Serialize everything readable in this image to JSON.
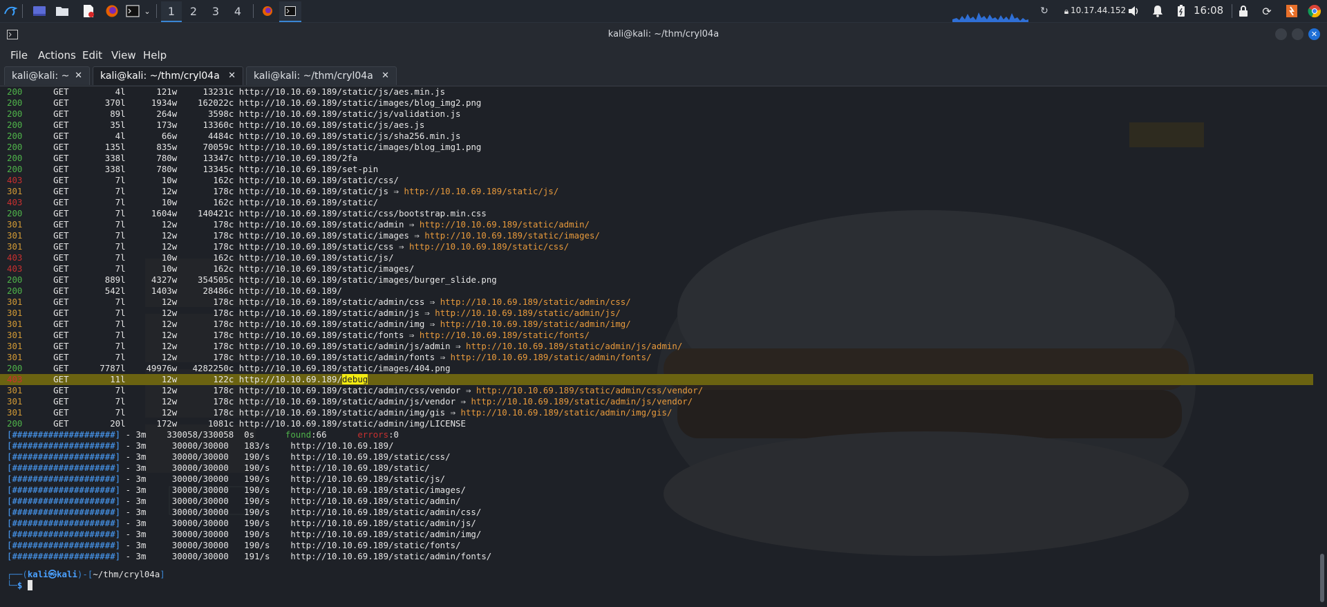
{
  "panel": {
    "workspaces": [
      "1",
      "2",
      "3",
      "4"
    ],
    "active_workspace": "1",
    "ip": "10.17.44.152",
    "time": "16:08"
  },
  "window": {
    "title": "kali@kali: ~/thm/cryl04a"
  },
  "menu": [
    "File",
    "Actions",
    "Edit",
    "View",
    "Help"
  ],
  "tabs": [
    {
      "label": "kali@kali: ~"
    },
    {
      "label": "kali@kali: ~/thm/cryl04a"
    },
    {
      "label": "kali@kali: ~/thm/cryl04a"
    }
  ],
  "results": [
    {
      "code": "200",
      "method": "GET",
      "lines": "4l",
      "words": "121w",
      "chars": "13231c",
      "url": "http://10.10.69.189/static/js/aes.min.js",
      "redirect": ""
    },
    {
      "code": "200",
      "method": "GET",
      "lines": "370l",
      "words": "1934w",
      "chars": "162022c",
      "url": "http://10.10.69.189/static/images/blog_img2.png",
      "redirect": ""
    },
    {
      "code": "200",
      "method": "GET",
      "lines": "89l",
      "words": "264w",
      "chars": "3598c",
      "url": "http://10.10.69.189/static/js/validation.js",
      "redirect": ""
    },
    {
      "code": "200",
      "method": "GET",
      "lines": "35l",
      "words": "173w",
      "chars": "13360c",
      "url": "http://10.10.69.189/static/js/aes.js",
      "redirect": ""
    },
    {
      "code": "200",
      "method": "GET",
      "lines": "4l",
      "words": "66w",
      "chars": "4484c",
      "url": "http://10.10.69.189/static/js/sha256.min.js",
      "redirect": ""
    },
    {
      "code": "200",
      "method": "GET",
      "lines": "135l",
      "words": "835w",
      "chars": "70059c",
      "url": "http://10.10.69.189/static/images/blog_img1.png",
      "redirect": ""
    },
    {
      "code": "200",
      "method": "GET",
      "lines": "338l",
      "words": "780w",
      "chars": "13347c",
      "url": "http://10.10.69.189/2fa",
      "redirect": ""
    },
    {
      "code": "200",
      "method": "GET",
      "lines": "338l",
      "words": "780w",
      "chars": "13345c",
      "url": "http://10.10.69.189/set-pin",
      "redirect": ""
    },
    {
      "code": "403",
      "method": "GET",
      "lines": "7l",
      "words": "10w",
      "chars": "162c",
      "url": "http://10.10.69.189/static/css/",
      "redirect": ""
    },
    {
      "code": "301",
      "method": "GET",
      "lines": "7l",
      "words": "12w",
      "chars": "178c",
      "url": "http://10.10.69.189/static/js",
      "redirect": "http://10.10.69.189/static/js/"
    },
    {
      "code": "403",
      "method": "GET",
      "lines": "7l",
      "words": "10w",
      "chars": "162c",
      "url": "http://10.10.69.189/static/",
      "redirect": ""
    },
    {
      "code": "200",
      "method": "GET",
      "lines": "7l",
      "words": "1604w",
      "chars": "140421c",
      "url": "http://10.10.69.189/static/css/bootstrap.min.css",
      "redirect": ""
    },
    {
      "code": "301",
      "method": "GET",
      "lines": "7l",
      "words": "12w",
      "chars": "178c",
      "url": "http://10.10.69.189/static/admin",
      "redirect": "http://10.10.69.189/static/admin/"
    },
    {
      "code": "301",
      "method": "GET",
      "lines": "7l",
      "words": "12w",
      "chars": "178c",
      "url": "http://10.10.69.189/static/images",
      "redirect": "http://10.10.69.189/static/images/"
    },
    {
      "code": "301",
      "method": "GET",
      "lines": "7l",
      "words": "12w",
      "chars": "178c",
      "url": "http://10.10.69.189/static/css",
      "redirect": "http://10.10.69.189/static/css/"
    },
    {
      "code": "403",
      "method": "GET",
      "lines": "7l",
      "words": "10w",
      "chars": "162c",
      "url": "http://10.10.69.189/static/js/",
      "redirect": ""
    },
    {
      "code": "403",
      "method": "GET",
      "lines": "7l",
      "words": "10w",
      "chars": "162c",
      "url": "http://10.10.69.189/static/images/",
      "redirect": ""
    },
    {
      "code": "200",
      "method": "GET",
      "lines": "889l",
      "words": "4327w",
      "chars": "354505c",
      "url": "http://10.10.69.189/static/images/burger_slide.png",
      "redirect": ""
    },
    {
      "code": "200",
      "method": "GET",
      "lines": "542l",
      "words": "1403w",
      "chars": "28486c",
      "url": "http://10.10.69.189/",
      "redirect": ""
    },
    {
      "code": "301",
      "method": "GET",
      "lines": "7l",
      "words": "12w",
      "chars": "178c",
      "url": "http://10.10.69.189/static/admin/css",
      "redirect": "http://10.10.69.189/static/admin/css/"
    },
    {
      "code": "301",
      "method": "GET",
      "lines": "7l",
      "words": "12w",
      "chars": "178c",
      "url": "http://10.10.69.189/static/admin/js",
      "redirect": "http://10.10.69.189/static/admin/js/"
    },
    {
      "code": "301",
      "method": "GET",
      "lines": "7l",
      "words": "12w",
      "chars": "178c",
      "url": "http://10.10.69.189/static/admin/img",
      "redirect": "http://10.10.69.189/static/admin/img/"
    },
    {
      "code": "301",
      "method": "GET",
      "lines": "7l",
      "words": "12w",
      "chars": "178c",
      "url": "http://10.10.69.189/static/fonts",
      "redirect": "http://10.10.69.189/static/fonts/"
    },
    {
      "code": "301",
      "method": "GET",
      "lines": "7l",
      "words": "12w",
      "chars": "178c",
      "url": "http://10.10.69.189/static/admin/js/admin",
      "redirect": "http://10.10.69.189/static/admin/js/admin/"
    },
    {
      "code": "301",
      "method": "GET",
      "lines": "7l",
      "words": "12w",
      "chars": "178c",
      "url": "http://10.10.69.189/static/admin/fonts",
      "redirect": "http://10.10.69.189/static/admin/fonts/"
    },
    {
      "code": "200",
      "method": "GET",
      "lines": "7787l",
      "words": "49976w",
      "chars": "4282250c",
      "url": "http://10.10.69.189/static/images/404.png",
      "redirect": ""
    },
    {
      "code": "403",
      "method": "GET",
      "lines": "11l",
      "words": "12w",
      "chars": "122c",
      "url": "http://10.10.69.189/",
      "url_highlight": "debug",
      "redirect": "",
      "highlight": true
    },
    {
      "code": "301",
      "method": "GET",
      "lines": "7l",
      "words": "12w",
      "chars": "178c",
      "url": "http://10.10.69.189/static/admin/css/vendor",
      "redirect": "http://10.10.69.189/static/admin/css/vendor/"
    },
    {
      "code": "301",
      "method": "GET",
      "lines": "7l",
      "words": "12w",
      "chars": "178c",
      "url": "http://10.10.69.189/static/admin/js/vendor",
      "redirect": "http://10.10.69.189/static/admin/js/vendor/"
    },
    {
      "code": "301",
      "method": "GET",
      "lines": "7l",
      "words": "12w",
      "chars": "178c",
      "url": "http://10.10.69.189/static/admin/img/gis",
      "redirect": "http://10.10.69.189/static/admin/img/gis/"
    },
    {
      "code": "200",
      "method": "GET",
      "lines": "20l",
      "words": "172w",
      "chars": "1081c",
      "url": "http://10.10.69.189/static/admin/img/LICENSE",
      "redirect": ""
    }
  ],
  "summary": {
    "bar": "[####################]",
    "time": "- 3m",
    "count": "330058/330058",
    "rate": "0s",
    "found_label": "found",
    "found": "66",
    "errors_label": "errors",
    "errors": "0"
  },
  "progress": [
    {
      "bar": "[####################]",
      "time": "- 3m",
      "count": "30000/30000",
      "rate": "183/s",
      "url": "http://10.10.69.189/"
    },
    {
      "bar": "[####################]",
      "time": "- 3m",
      "count": "30000/30000",
      "rate": "190/s",
      "url": "http://10.10.69.189/static/css/"
    },
    {
      "bar": "[####################]",
      "time": "- 3m",
      "count": "30000/30000",
      "rate": "190/s",
      "url": "http://10.10.69.189/static/"
    },
    {
      "bar": "[####################]",
      "time": "- 3m",
      "count": "30000/30000",
      "rate": "190/s",
      "url": "http://10.10.69.189/static/js/"
    },
    {
      "bar": "[####################]",
      "time": "- 3m",
      "count": "30000/30000",
      "rate": "190/s",
      "url": "http://10.10.69.189/static/images/"
    },
    {
      "bar": "[####################]",
      "time": "- 3m",
      "count": "30000/30000",
      "rate": "190/s",
      "url": "http://10.10.69.189/static/admin/"
    },
    {
      "bar": "[####################]",
      "time": "- 3m",
      "count": "30000/30000",
      "rate": "190/s",
      "url": "http://10.10.69.189/static/admin/css/"
    },
    {
      "bar": "[####################]",
      "time": "- 3m",
      "count": "30000/30000",
      "rate": "190/s",
      "url": "http://10.10.69.189/static/admin/js/"
    },
    {
      "bar": "[####################]",
      "time": "- 3m",
      "count": "30000/30000",
      "rate": "190/s",
      "url": "http://10.10.69.189/static/admin/img/"
    },
    {
      "bar": "[####################]",
      "time": "- 3m",
      "count": "30000/30000",
      "rate": "190/s",
      "url": "http://10.10.69.189/static/fonts/"
    },
    {
      "bar": "[####################]",
      "time": "- 3m",
      "count": "30000/30000",
      "rate": "191/s",
      "url": "http://10.10.69.189/static/admin/fonts/"
    }
  ],
  "prompt": {
    "user": "kali",
    "at": "㉿",
    "host": "kali",
    "cwd": "~/thm/cryl04a",
    "symbol": "$"
  },
  "colors": {
    "ok": "#4fb34a",
    "redirect": "#d39a35",
    "forbidden": "#c8302f",
    "accent": "#3a86d4"
  }
}
